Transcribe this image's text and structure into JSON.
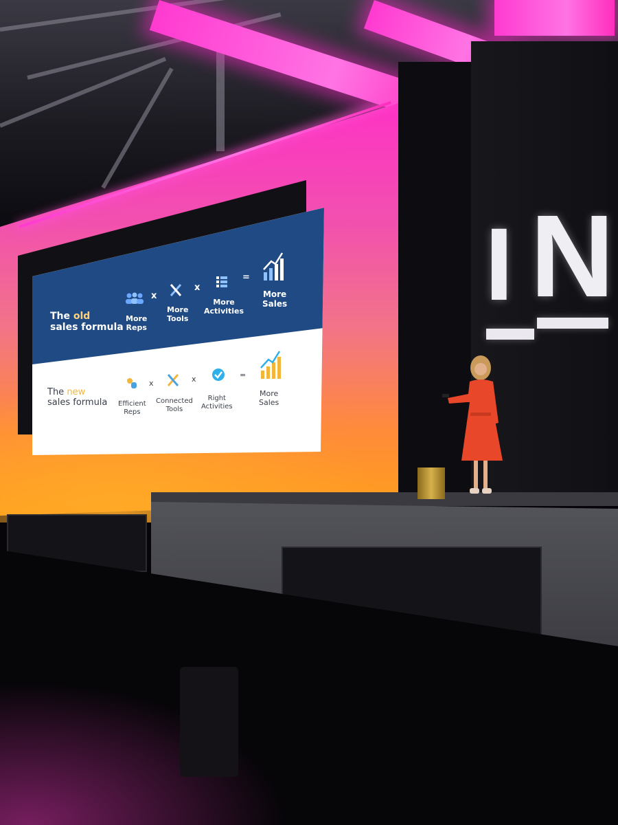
{
  "slide": {
    "old_row": {
      "label_prefix": "The",
      "label_accent": "old",
      "label_suffix": "sales formula",
      "items": [
        "More\nReps",
        "More\nTools",
        "More\nActivities",
        "More\nSales"
      ],
      "ops": [
        "x",
        "x",
        "="
      ]
    },
    "new_row": {
      "label_prefix": "The",
      "label_accent": "new",
      "label_suffix": "sales formula",
      "items": [
        "Efficient\nReps",
        "Connected\nTools",
        "Right\nActivities",
        "More\nSales"
      ],
      "ops": [
        "x",
        "x",
        "="
      ]
    }
  },
  "backdrop_logo": {
    "letters": [
      "I",
      "N"
    ]
  },
  "colors": {
    "lighting_magenta": "#ff2fc7",
    "lighting_orange": "#ffa01a",
    "slide_blue": "#1f4a83",
    "speaker_dress": "#e8472a"
  }
}
